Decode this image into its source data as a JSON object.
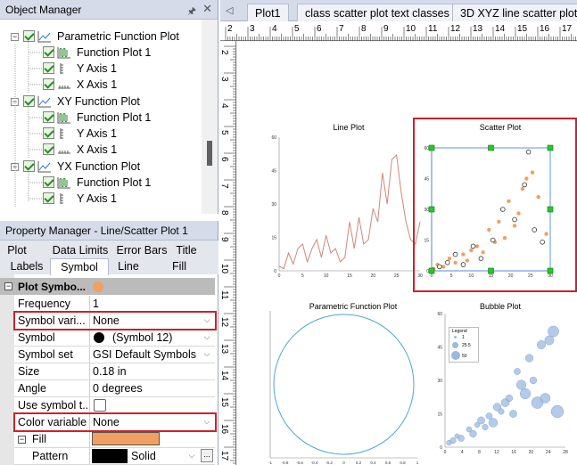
{
  "object_manager": {
    "title": "Object Manager",
    "pin": "🖈",
    "close": "✕",
    "items": [
      {
        "label": "Parametric Function Plot"
      },
      {
        "label": "Function Plot 1"
      },
      {
        "label": "Y Axis 1"
      },
      {
        "label": "X Axis 1"
      },
      {
        "label": "XY Function Plot"
      },
      {
        "label": "Function Plot 1"
      },
      {
        "label": "Y Axis 1"
      },
      {
        "label": "X Axis 1"
      },
      {
        "label": "YX Function Plot"
      },
      {
        "label": "Function Plot 1"
      },
      {
        "label": "Y Axis 1"
      }
    ]
  },
  "property_manager": {
    "title": "Property Manager - Line/Scatter Plot 1",
    "tabs_row1": [
      "Plot",
      "Data Limits",
      "Error Bars",
      "Title"
    ],
    "tabs_row2": [
      "Labels",
      "Symbol",
      "Line",
      "Fill"
    ],
    "selected_tab": "Symbol",
    "section": "Plot Symbo...",
    "section_color": "#f0a060",
    "rows": [
      {
        "key": "Frequency",
        "value": "1"
      },
      {
        "key": "Symbol vari...",
        "value": "None"
      },
      {
        "key": "Symbol",
        "value": "(Symbol 12)"
      },
      {
        "key": "Symbol set",
        "value": "GSI Default Symbols"
      },
      {
        "key": "Size",
        "value": "0.18 in"
      },
      {
        "key": "Angle",
        "value": "0 degrees"
      },
      {
        "key": "Use symbol t...",
        "value": ""
      },
      {
        "key": "Color variable",
        "value": "None"
      },
      {
        "key": "Fill",
        "value": ""
      },
      {
        "key": "Pattern",
        "value": "Solid"
      }
    ],
    "fill_color": "#f0a060",
    "pattern_color": "#000000",
    "ellipsis": "..."
  },
  "document": {
    "tabs": [
      "Plot1",
      "class scatter plot text classes *",
      "3D XYZ line scatter plot *"
    ],
    "nav_left": "◁",
    "hruler_labels": [
      "2",
      "3",
      "4",
      "5",
      "6",
      "7",
      "8",
      "9",
      "10",
      "11",
      "12",
      "13",
      "14",
      "15",
      "16",
      "17"
    ],
    "vruler_labels": [
      "2",
      "3",
      "4",
      "5",
      "6",
      "7",
      "8",
      "9",
      "10",
      "11",
      "12",
      "13",
      "14",
      "15",
      "16",
      "17"
    ]
  },
  "charts": {
    "line": {
      "title": "Line Plot"
    },
    "scatter": {
      "title": "Scatter Plot"
    },
    "parametric": {
      "title": "Parametric Function Plot"
    },
    "bubble": {
      "title": "Bubble Plot",
      "legend_title": "Legend",
      "legend_items": [
        "1",
        "25.5",
        "50"
      ]
    }
  },
  "chart_data": [
    {
      "type": "line",
      "title": "Line Plot",
      "xlim": [
        0,
        30
      ],
      "ylim": [
        0,
        60
      ],
      "xticks": [
        "0",
        "5",
        "10",
        "15",
        "20",
        "25",
        "30"
      ],
      "yticks": [
        "0",
        "15",
        "30",
        "45",
        "60"
      ],
      "x": [
        0,
        1,
        2,
        3,
        4,
        5,
        6,
        7,
        8,
        9,
        10,
        11,
        12,
        13,
        14,
        15,
        16,
        17,
        18,
        19,
        20,
        21,
        22,
        23,
        24,
        25,
        26,
        27,
        28,
        29,
        30
      ],
      "y": [
        2,
        1,
        8,
        3,
        10,
        12,
        4,
        10,
        14,
        6,
        16,
        8,
        10,
        4,
        6,
        22,
        10,
        24,
        12,
        14,
        28,
        22,
        44,
        30,
        50,
        52,
        35,
        22,
        14,
        12,
        22
      ],
      "color": "#d08878"
    },
    {
      "type": "scatter",
      "title": "Scatter Plot",
      "xlim": [
        0,
        30
      ],
      "ylim": [
        0,
        60
      ],
      "xticks": [
        "0",
        "5",
        "10",
        "15",
        "20",
        "25",
        "30"
      ],
      "yticks": [
        "0",
        "15",
        "30",
        "45",
        "60"
      ],
      "series": [
        {
          "marker": "filled",
          "color": "#f0a060",
          "x": [
            0.5,
            1.5,
            3,
            4.5,
            6,
            8,
            9,
            10,
            11.5,
            13,
            14.5,
            16,
            17,
            18.5,
            19.5,
            21,
            22,
            23,
            24,
            25.5,
            27,
            29
          ],
          "y": [
            1,
            3,
            2,
            6,
            4,
            8,
            5,
            10,
            12,
            9,
            20,
            14,
            24,
            16,
            34,
            22,
            28,
            40,
            45,
            48,
            36,
            18
          ]
        },
        {
          "marker": "open",
          "color": "#333333",
          "x": [
            2,
            4,
            6,
            8,
            10.5,
            12.5,
            15.5,
            18,
            21,
            23.5,
            24.5,
            26,
            28
          ],
          "y": [
            2,
            4,
            8,
            3,
            12,
            6,
            15,
            30,
            25,
            42,
            58,
            20,
            14
          ]
        }
      ]
    },
    {
      "type": "line",
      "title": "Parametric Function Plot",
      "shape": "circle",
      "xlim": [
        -1,
        1
      ],
      "ylim": [
        -1,
        1
      ],
      "xticks": [
        "-1",
        "-0.8",
        "-0.6",
        "-0.4",
        "-0.2",
        "0",
        "0.2",
        "0.4",
        "0.6",
        "0.8",
        "1"
      ],
      "color": "#4aa8d8"
    },
    {
      "type": "scatter",
      "title": "Bubble Plot",
      "xlim": [
        0,
        30
      ],
      "ylim": [
        0,
        60
      ],
      "xticks": [
        "0",
        "4",
        "8",
        "12",
        "16",
        "20",
        "24",
        "28"
      ],
      "yticks": [
        "0",
        "15",
        "30",
        "45",
        "60"
      ],
      "legend": [
        "1",
        "25.5",
        "50"
      ],
      "x": [
        1,
        2,
        3,
        4,
        6,
        7,
        8,
        9,
        10,
        11,
        12,
        13,
        14,
        15,
        16,
        17,
        18,
        19,
        20,
        21,
        22,
        23,
        24,
        25,
        26,
        27,
        28
      ],
      "y": [
        2,
        3,
        5,
        4,
        8,
        6,
        10,
        12,
        9,
        14,
        11,
        18,
        16,
        20,
        22,
        15,
        34,
        28,
        24,
        40,
        30,
        20,
        46,
        22,
        48,
        52,
        16
      ],
      "size": [
        4,
        6,
        3,
        8,
        5,
        10,
        4,
        12,
        6,
        8,
        20,
        14,
        6,
        16,
        10,
        12,
        8,
        24,
        30,
        14,
        10,
        40,
        18,
        26,
        22,
        34,
        46
      ],
      "color": "#9ab8e0"
    }
  ]
}
